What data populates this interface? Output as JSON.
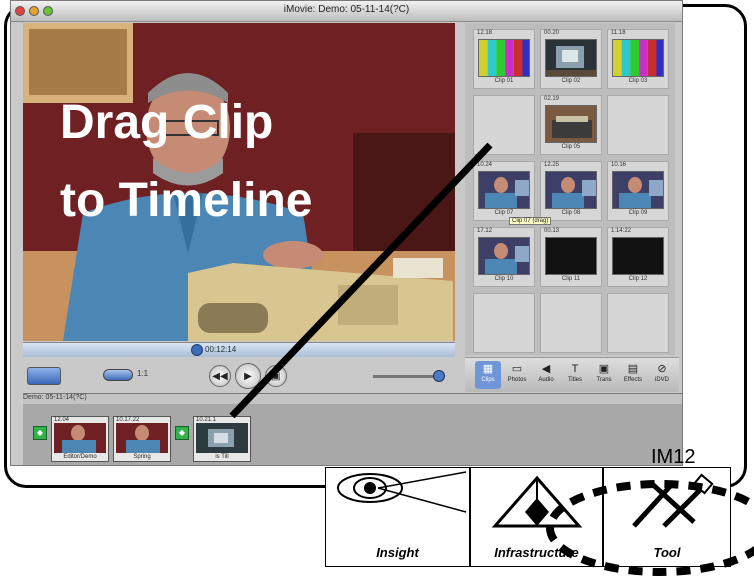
{
  "window": {
    "title": "iMovie: Demo: 05-11-14(?C)"
  },
  "overlay": {
    "line1": "Drag Clip",
    "line2": "to Timeline",
    "slide_id": "IM12"
  },
  "scrubber": {
    "timecode": "00:12:14"
  },
  "shelf": {
    "clips": [
      {
        "tc": "12.18",
        "name": "Clip 01",
        "kind": "bars"
      },
      {
        "tc": "00.20",
        "name": "Clip 02",
        "kind": "desk"
      },
      {
        "tc": "11.18",
        "name": "Clip 03",
        "kind": "bars"
      },
      {
        "tc": "",
        "name": "",
        "kind": "empty"
      },
      {
        "tc": "02.19",
        "name": "Clip 05",
        "kind": "typewriter"
      },
      {
        "tc": "",
        "name": "",
        "kind": "empty"
      },
      {
        "tc": "10.24",
        "name": "Clip 07",
        "kind": "person"
      },
      {
        "tc": "12.25",
        "name": "Clip 08",
        "kind": "person"
      },
      {
        "tc": "10.16",
        "name": "Clip 09",
        "kind": "person"
      },
      {
        "tc": "17.12",
        "name": "Clip 10",
        "kind": "person"
      },
      {
        "tc": "00.13",
        "name": "Clip 11",
        "kind": "dark"
      },
      {
        "tc": "1:14:22",
        "name": "Clip 12",
        "kind": "dark"
      },
      {
        "tc": "",
        "name": "",
        "kind": "empty"
      },
      {
        "tc": "",
        "name": "",
        "kind": "empty"
      },
      {
        "tc": "",
        "name": "",
        "kind": "empty"
      }
    ],
    "tooltip": "Clip 07 (drag)"
  },
  "panes": [
    {
      "label": "Clips",
      "glyph": "▦",
      "active": true
    },
    {
      "label": "Photos",
      "glyph": "▭"
    },
    {
      "label": "Audio",
      "glyph": "◀"
    },
    {
      "label": "Titles",
      "glyph": "T"
    },
    {
      "label": "Trans",
      "glyph": "▣"
    },
    {
      "label": "Effects",
      "glyph": "▤"
    },
    {
      "label": "iDVD",
      "glyph": "⊘"
    }
  ],
  "controls": {
    "volume_label": "1:1"
  },
  "timeline": {
    "header": "Demo: 05-11-14(?C)",
    "clips": [
      {
        "tc": "12.04",
        "label": "Editor/Demo"
      },
      {
        "tc": "10.17.22",
        "label": "Spring"
      },
      {
        "tc": "10.21.1",
        "label": "is Till"
      }
    ]
  },
  "icons": {
    "insight": "Insight",
    "infrastructure": "Infrastructure",
    "tool": "Tool"
  },
  "colors": {
    "accent": "#3c6db6",
    "transition": "#33b14b",
    "wall": "#7b2426"
  }
}
